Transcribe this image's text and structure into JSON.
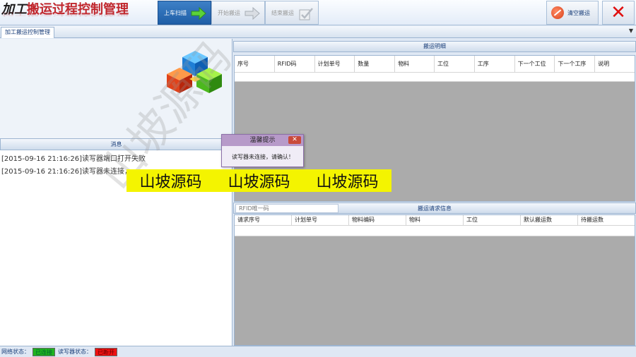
{
  "app": {
    "title_prefix": "加工",
    "title_main": "搬运过程控制管理"
  },
  "toolbar": {
    "scan_label": "上车扫描",
    "start_label": "开始搬运",
    "finish_label": "结束搬运",
    "clear_label": "清空搬运",
    "exit_symbol": "✕"
  },
  "tab": {
    "label": "加工搬运控制管理"
  },
  "messages": {
    "header": "消息",
    "lines": [
      "[2015-09-16 21:16:26]读写器端口打开失败",
      "[2015-09-16 21:16:26]读写器未连接，"
    ]
  },
  "detail": {
    "header": "搬运明细",
    "columns": [
      "序号",
      "RFID码",
      "计划单号",
      "数量",
      "物料",
      "工位",
      "工序",
      "下一个工位",
      "下一个工序",
      "说明"
    ]
  },
  "request": {
    "rfid_placeholder": "RFID唯一码",
    "header": "搬运请求信息",
    "columns": [
      "请求序号",
      "计划单号",
      "物料编码",
      "物料",
      "工位",
      "默认搬运数",
      "待搬运数"
    ]
  },
  "status": {
    "network_label": "网络状态：",
    "network_value": "已连接",
    "reader_label": "读写器状态：",
    "reader_value": "已断开"
  },
  "dialog": {
    "title": "温馨提示",
    "message": "读写器未连接，请确认！",
    "close": "✕"
  },
  "watermark": {
    "banner": [
      "山坡源码",
      "山坡源码",
      "山坡源码"
    ],
    "diagonal": "山坡源码"
  }
}
